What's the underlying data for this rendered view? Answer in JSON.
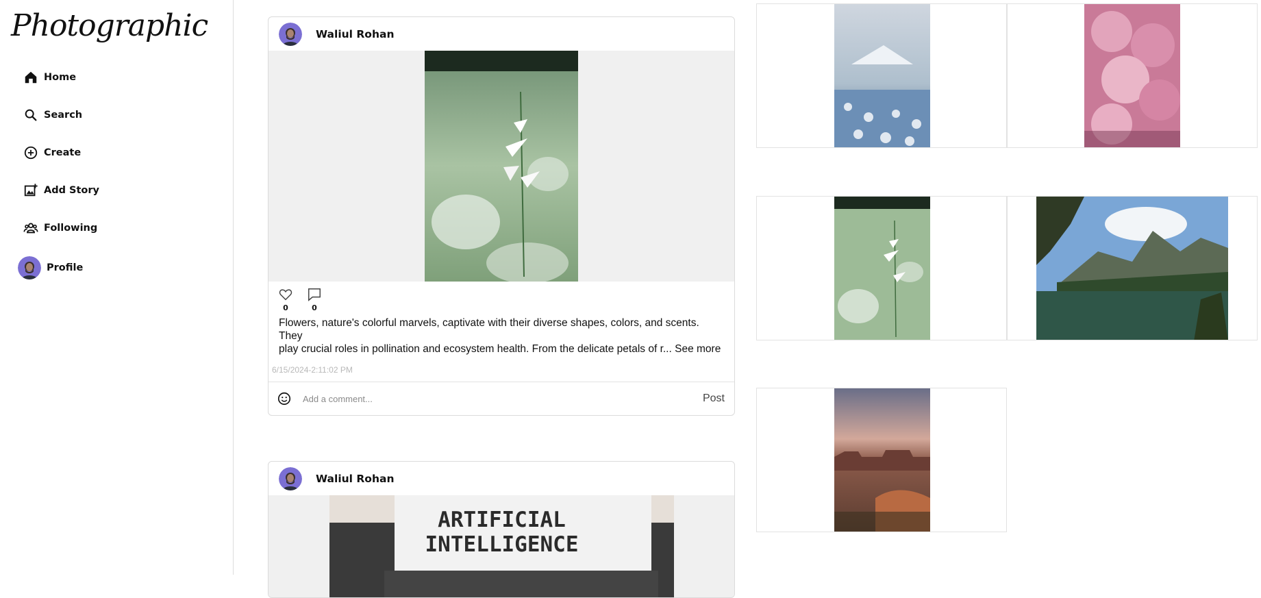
{
  "app": {
    "logo": "Photographic"
  },
  "nav": {
    "home": "Home",
    "search": "Search",
    "create": "Create",
    "add_story": "Add Story",
    "following": "Following",
    "profile": "Profile"
  },
  "posts": [
    {
      "author": "Waliul Rohan",
      "likes": "0",
      "comments": "0",
      "caption_line1": "Flowers, nature's colorful marvels, captivate with their diverse shapes, colors, and scents. They",
      "caption_line2": "play crucial roles in pollination and ecosystem health. From the delicate petals of r...",
      "see_more": "See more",
      "timestamp": "6/15/2024-2:11:02 PM",
      "comment_placeholder": "Add a comment...",
      "post_label": "Post"
    },
    {
      "author": "Waliul Rohan",
      "image_text_line1": "ARTIFICIAL",
      "image_text_line2": "INTELLIGENCE"
    }
  ],
  "colors": {
    "accent": "#111111",
    "border": "#dbdbdb",
    "muted": "#b8b8b8"
  }
}
